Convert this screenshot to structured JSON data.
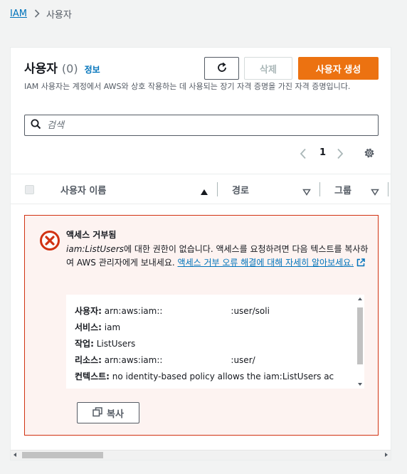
{
  "breadcrumb": {
    "root": "IAM",
    "current": "사용자"
  },
  "header": {
    "title": "사용자",
    "count": "(0)",
    "info_link": "정보",
    "description": "IAM 사용자는 계정에서 AWS와 상호 작용하는 데 사용되는 장기 자격 증명을 가진 자격 증명입니다."
  },
  "buttons": {
    "delete": "삭제",
    "create": "사용자 생성"
  },
  "search": {
    "placeholder": "검색"
  },
  "pagination": {
    "current_page": "1"
  },
  "table": {
    "columns": [
      "사용자 이름",
      "경로",
      "그룹"
    ]
  },
  "error": {
    "title": "액세스 거부됨",
    "action": "iam:ListUsers",
    "message_part1": "에 대한 권한이 없습니다. 액세스를 요청하려면 다음 텍스트를 복사하여 AWS 관리자에게 보내세요.",
    "link_text": "액세스 거부 오류 해결에 대해 자세히 알아보세요.",
    "details": [
      {
        "key": "사용자:",
        "value": "arn:aws:iam::",
        "suffix": ":user/soli"
      },
      {
        "key": "서비스:",
        "value": "iam",
        "suffix": ""
      },
      {
        "key": "작업:",
        "value": "ListUsers",
        "suffix": ""
      },
      {
        "key": "리소스:",
        "value": "arn:aws:iam::",
        "suffix": ":user/"
      },
      {
        "key": "컨텍스트:",
        "value": "no identity-based policy allows the iam:ListUsers ac",
        "suffix": ""
      }
    ],
    "copy_button": "복사"
  },
  "colors": {
    "accent": "#ec7211",
    "link": "#0073bb",
    "error_border": "#d13212",
    "error_bg": "#fdf3f1"
  }
}
